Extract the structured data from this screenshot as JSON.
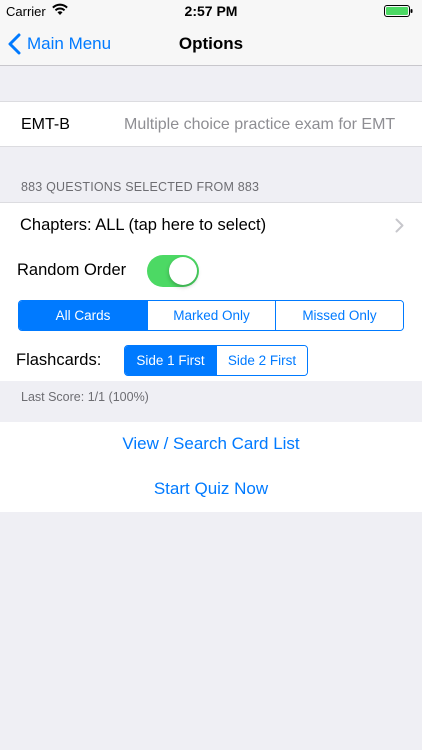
{
  "status_bar": {
    "carrier": "Carrier",
    "time": "2:57 PM",
    "battery_color": "#4cd964"
  },
  "nav": {
    "back_label": "Main Menu",
    "title": "Options"
  },
  "exam": {
    "name": "EMT-B",
    "description": "Multiple choice practice exam for EMT"
  },
  "section_header": "883 QUESTIONS SELECTED FROM 883",
  "options": {
    "chapters_label": "Chapters: ALL (tap here to select)",
    "random_order_label": "Random Order",
    "random_order_on": true,
    "card_filter": {
      "options": [
        "All Cards",
        "Marked Only",
        "Missed Only"
      ],
      "selected": "All Cards"
    },
    "flashcards_label": "Flashcards:",
    "flashcards": {
      "options": [
        "Side 1 First",
        "Side 2 First"
      ],
      "selected": "Side 1 First"
    }
  },
  "last_score": "Last Score: 1/1 (100%)",
  "actions": {
    "view_label": "View / Search Card List",
    "start_label": "Start Quiz Now"
  },
  "colors": {
    "accent": "#007aff",
    "toggle_on": "#4cd964",
    "background": "#efeff4"
  }
}
